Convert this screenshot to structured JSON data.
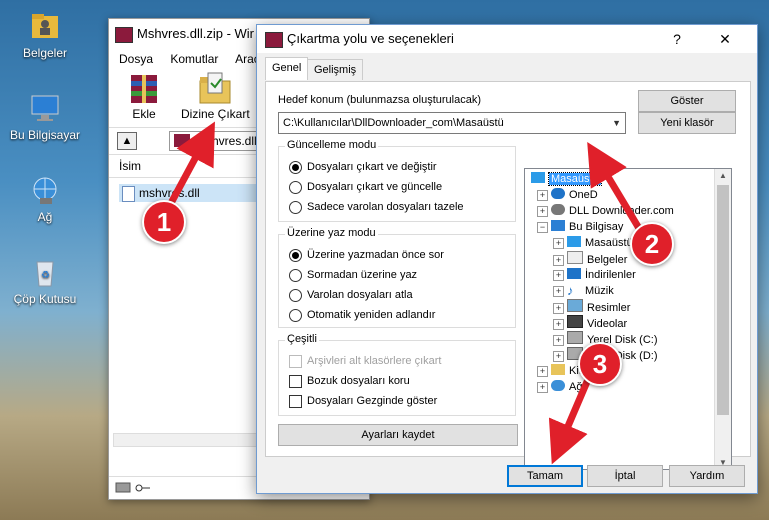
{
  "desktop": {
    "icons": [
      {
        "label": "Belgeler"
      },
      {
        "label": "Bu Bilgisayar"
      },
      {
        "label": "Ağ"
      },
      {
        "label": "Çöp Kutusu"
      }
    ]
  },
  "winrar": {
    "title": "Mshvres.dll.zip - Wir",
    "menu": [
      "Dosya",
      "Komutlar",
      "Araçla"
    ],
    "toolbar": {
      "add_label": "Ekle",
      "extract_label": "Dizine Çıkart"
    },
    "path": "Mshvres.dll",
    "column_name": "İsim",
    "file": "mshvres.dll"
  },
  "dialog": {
    "title": "Çıkartma yolu ve seçenekleri",
    "help_glyph": "?",
    "close_glyph": "✕",
    "tabs": [
      "Genel",
      "Gelişmiş"
    ],
    "target_label": "Hedef konum (bulunmazsa oluşturulacak)",
    "target_value": "C:\\Kullanıcılar\\DllDownloader_com\\Masaüstü",
    "show_button": "Göster",
    "new_folder_button": "Yeni klasör",
    "update_mode": {
      "title": "Güncelleme modu",
      "options": [
        "Dosyaları çıkart ve değiştir",
        "Dosyaları çıkart ve güncelle",
        "Sadece varolan dosyaları tazele"
      ],
      "selected": 0
    },
    "overwrite_mode": {
      "title": "Üzerine yaz modu",
      "options": [
        "Üzerine yazmadan önce sor",
        "Sormadan üzerine yaz",
        "Varolan dosyaları atla",
        "Otomatik yeniden adlandır"
      ],
      "selected": 0
    },
    "misc": {
      "title": "Çeşitli",
      "options": [
        "Arşivleri alt klasörlere çıkart",
        "Bozuk dosyaları koru",
        "Dosyaları Gezginde göster"
      ]
    },
    "save_settings_button": "Ayarları kaydet",
    "tree": [
      {
        "label": "Masaüstü"
      },
      {
        "label": "OneD"
      },
      {
        "label": "DLL Downloader.com"
      },
      {
        "label": "Bu Bilgisay"
      },
      {
        "label": "Masaüstü"
      },
      {
        "label": "Belgeler"
      },
      {
        "label": "İndirilenler"
      },
      {
        "label": "Müzik"
      },
      {
        "label": "Resimler"
      },
      {
        "label": "Videolar"
      },
      {
        "label": "Yerel Disk (C:)"
      },
      {
        "label": "Yerel Disk (D:)"
      },
      {
        "label": "Kitapl"
      },
      {
        "label": "Ağ"
      }
    ],
    "ok_button": "Tamam",
    "cancel_button": "İptal",
    "help_button": "Yardım"
  },
  "annotations": {
    "step1": "1",
    "step2": "2",
    "step3": "3",
    "arrow_color": "#e0202a"
  }
}
